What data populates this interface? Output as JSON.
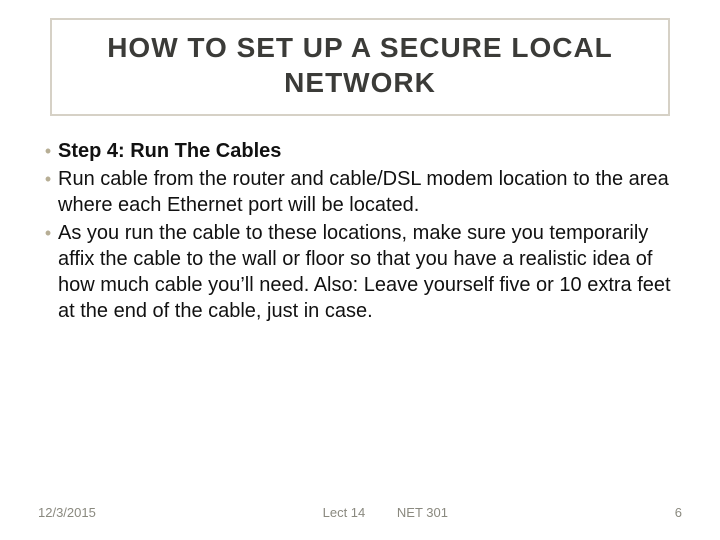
{
  "title": "HOW TO SET UP A SECURE LOCAL NETWORK",
  "bullets": [
    {
      "text": "Step 4: Run The Cables",
      "bold": true
    },
    {
      "text": "Run cable from the router and cable/DSL modem location to the area where each Ethernet port will be located.",
      "bold": false
    },
    {
      "text": "As you run the cable to these locations, make sure you temporarily affix the cable to the wall or floor so that you have a realistic idea of how much cable you’ll need. Also: Leave yourself five or 10 extra feet at the end of the cable, just in case.",
      "bold": false
    }
  ],
  "footer": {
    "date": "12/3/2015",
    "lecture": "Lect 14",
    "course": "NET 301",
    "page": "6"
  }
}
